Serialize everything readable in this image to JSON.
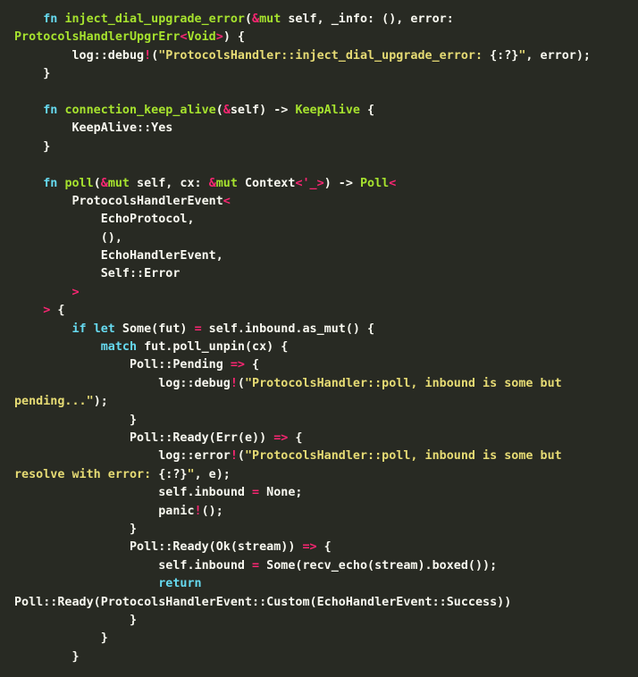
{
  "editor": {
    "language": "rust",
    "background_color": "#282a23",
    "foreground_color": "#f8f8f0",
    "theme_colors": {
      "keyword": "#66d9ef",
      "function_name": "#a6e22e",
      "type_name": "#a6e22e",
      "operator": "#f92672",
      "string": "#e6db74",
      "plain": "#f8f8f0"
    }
  },
  "code": {
    "lines": [
      {
        "n": 1,
        "text": "    fn inject_dial_upgrade_error(&mut self, _info: (), error:",
        "tokens": [
          {
            "t": "    ",
            "c": "t-plain"
          },
          {
            "t": "fn",
            "c": "t-kw"
          },
          {
            "t": " ",
            "c": "t-plain"
          },
          {
            "t": "inject_dial_upgrade_error",
            "c": "t-fname"
          },
          {
            "t": "(",
            "c": "t-plain"
          },
          {
            "t": "&",
            "c": "t-op"
          },
          {
            "t": "mut",
            "c": "t-mut"
          },
          {
            "t": " self, _info: (), error:",
            "c": "t-plain"
          }
        ]
      },
      {
        "n": 2,
        "text": "ProtocolsHandlerUpgrErr<Void>) {",
        "wrapped": true,
        "tokens": [
          {
            "t": "ProtocolsHandlerUpgrErr",
            "c": "t-fname"
          },
          {
            "t": "<",
            "c": "t-op"
          },
          {
            "t": "Void",
            "c": "t-fname"
          },
          {
            "t": ">",
            "c": "t-op"
          },
          {
            "t": ") {",
            "c": "t-plain"
          }
        ]
      },
      {
        "n": 3,
        "text": "        log::debug!(\"ProtocolsHandler::inject_dial_upgrade_error: {:?}\", error);",
        "tokens": [
          {
            "t": "        log::debug",
            "c": "t-plain"
          },
          {
            "t": "!",
            "c": "t-op"
          },
          {
            "t": "(",
            "c": "t-plain"
          },
          {
            "t": "\"ProtocolsHandler::inject_dial_upgrade_error: ",
            "c": "t-str"
          },
          {
            "t": "{:?}",
            "c": "t-strfmt"
          },
          {
            "t": "\"",
            "c": "t-str"
          },
          {
            "t": ", error);",
            "c": "t-plain"
          }
        ]
      },
      {
        "n": 4,
        "text": "    }",
        "tokens": [
          {
            "t": "    }",
            "c": "t-brace"
          }
        ]
      },
      {
        "n": 5,
        "text": "",
        "tokens": []
      },
      {
        "n": 6,
        "text": "    fn connection_keep_alive(&self) -> KeepAlive {",
        "tokens": [
          {
            "t": "    ",
            "c": "t-plain"
          },
          {
            "t": "fn",
            "c": "t-kw"
          },
          {
            "t": " ",
            "c": "t-plain"
          },
          {
            "t": "connection_keep_alive",
            "c": "t-fname"
          },
          {
            "t": "(",
            "c": "t-plain"
          },
          {
            "t": "&",
            "c": "t-op"
          },
          {
            "t": "self) -> ",
            "c": "t-plain"
          },
          {
            "t": "KeepAlive",
            "c": "t-type"
          },
          {
            "t": " {",
            "c": "t-plain"
          }
        ]
      },
      {
        "n": 7,
        "text": "        KeepAlive::Yes",
        "tokens": [
          {
            "t": "        KeepAlive::Yes",
            "c": "t-plain"
          }
        ]
      },
      {
        "n": 8,
        "text": "    }",
        "tokens": [
          {
            "t": "    }",
            "c": "t-brace"
          }
        ]
      },
      {
        "n": 9,
        "text": "",
        "tokens": []
      },
      {
        "n": 10,
        "text": "    fn poll(&mut self, cx: &mut Context<'_>) -> Poll<",
        "tokens": [
          {
            "t": "    ",
            "c": "t-plain"
          },
          {
            "t": "fn",
            "c": "t-kw"
          },
          {
            "t": " ",
            "c": "t-plain"
          },
          {
            "t": "poll",
            "c": "t-fname"
          },
          {
            "t": "(",
            "c": "t-plain"
          },
          {
            "t": "&",
            "c": "t-op"
          },
          {
            "t": "mut",
            "c": "t-mut"
          },
          {
            "t": " self, cx: ",
            "c": "t-plain"
          },
          {
            "t": "&",
            "c": "t-op"
          },
          {
            "t": "mut",
            "c": "t-mut"
          },
          {
            "t": " Context",
            "c": "t-plain"
          },
          {
            "t": "<'_>",
            "c": "t-op"
          },
          {
            "t": ") -> ",
            "c": "t-plain"
          },
          {
            "t": "Poll",
            "c": "t-type"
          },
          {
            "t": "<",
            "c": "t-op"
          }
        ]
      },
      {
        "n": 11,
        "text": "        ProtocolsHandlerEvent<",
        "tokens": [
          {
            "t": "        ProtocolsHandlerEvent",
            "c": "t-plain"
          },
          {
            "t": "<",
            "c": "t-op"
          }
        ]
      },
      {
        "n": 12,
        "text": "            EchoProtocol,",
        "tokens": [
          {
            "t": "            EchoProtocol,",
            "c": "t-plain"
          }
        ]
      },
      {
        "n": 13,
        "text": "            (),",
        "tokens": [
          {
            "t": "            (),",
            "c": "t-plain"
          }
        ]
      },
      {
        "n": 14,
        "text": "            EchoHandlerEvent,",
        "tokens": [
          {
            "t": "            EchoHandlerEvent,",
            "c": "t-plain"
          }
        ]
      },
      {
        "n": 15,
        "text": "            Self::Error",
        "tokens": [
          {
            "t": "            Self::Error",
            "c": "t-plain"
          }
        ]
      },
      {
        "n": 16,
        "text": "        >",
        "tokens": [
          {
            "t": "        ",
            "c": "t-plain"
          },
          {
            "t": ">",
            "c": "t-op"
          }
        ]
      },
      {
        "n": 17,
        "text": "    > {",
        "tokens": [
          {
            "t": "    ",
            "c": "t-plain"
          },
          {
            "t": ">",
            "c": "t-op"
          },
          {
            "t": " {",
            "c": "t-plain"
          }
        ]
      },
      {
        "n": 18,
        "text": "        if let Some(fut) = self.inbound.as_mut() {",
        "tokens": [
          {
            "t": "        ",
            "c": "t-plain"
          },
          {
            "t": "if",
            "c": "t-kw"
          },
          {
            "t": " ",
            "c": "t-plain"
          },
          {
            "t": "let",
            "c": "t-kw"
          },
          {
            "t": " Some(fut) ",
            "c": "t-plain"
          },
          {
            "t": "=",
            "c": "t-op"
          },
          {
            "t": " self.inbound.as_mut() {",
            "c": "t-plain"
          }
        ]
      },
      {
        "n": 19,
        "text": "            match fut.poll_unpin(cx) {",
        "tokens": [
          {
            "t": "            ",
            "c": "t-plain"
          },
          {
            "t": "match",
            "c": "t-kw"
          },
          {
            "t": " fut.poll_unpin(cx) {",
            "c": "t-plain"
          }
        ]
      },
      {
        "n": 20,
        "text": "                Poll::Pending => {",
        "tokens": [
          {
            "t": "                Poll::Pending ",
            "c": "t-plain"
          },
          {
            "t": "=>",
            "c": "t-op"
          },
          {
            "t": " {",
            "c": "t-plain"
          }
        ]
      },
      {
        "n": 21,
        "text": "                    log::debug!(\"ProtocolsHandler::poll, inbound is some but",
        "tokens": [
          {
            "t": "                    log::debug",
            "c": "t-plain"
          },
          {
            "t": "!",
            "c": "t-op"
          },
          {
            "t": "(",
            "c": "t-plain"
          },
          {
            "t": "\"ProtocolsHandler::poll, inbound is some but",
            "c": "t-str"
          }
        ]
      },
      {
        "n": 22,
        "text": "pending...\");",
        "wrapped": true,
        "tokens": [
          {
            "t": "pending...\"",
            "c": "t-str"
          },
          {
            "t": ");",
            "c": "t-plain"
          }
        ]
      },
      {
        "n": 23,
        "text": "                }",
        "tokens": [
          {
            "t": "                }",
            "c": "t-brace"
          }
        ]
      },
      {
        "n": 24,
        "text": "                Poll::Ready(Err(e)) => {",
        "tokens": [
          {
            "t": "                Poll::Ready(Err(e)) ",
            "c": "t-plain"
          },
          {
            "t": "=>",
            "c": "t-op"
          },
          {
            "t": " {",
            "c": "t-plain"
          }
        ]
      },
      {
        "n": 25,
        "text": "                    log::error!(\"ProtocolsHandler::poll, inbound is some but",
        "tokens": [
          {
            "t": "                    log::error",
            "c": "t-plain"
          },
          {
            "t": "!",
            "c": "t-op"
          },
          {
            "t": "(",
            "c": "t-plain"
          },
          {
            "t": "\"ProtocolsHandler::poll, inbound is some but",
            "c": "t-str"
          }
        ]
      },
      {
        "n": 26,
        "text": "resolve with error: {:?}\", e);",
        "wrapped": true,
        "tokens": [
          {
            "t": "resolve with error: ",
            "c": "t-str"
          },
          {
            "t": "{:?}",
            "c": "t-strfmt"
          },
          {
            "t": "\"",
            "c": "t-str"
          },
          {
            "t": ", e);",
            "c": "t-plain"
          }
        ]
      },
      {
        "n": 27,
        "text": "                    self.inbound = None;",
        "tokens": [
          {
            "t": "                    self.inbound ",
            "c": "t-plain"
          },
          {
            "t": "=",
            "c": "t-op"
          },
          {
            "t": " None;",
            "c": "t-plain"
          }
        ]
      },
      {
        "n": 28,
        "text": "                    panic!();",
        "tokens": [
          {
            "t": "                    panic",
            "c": "t-plain"
          },
          {
            "t": "!",
            "c": "t-op"
          },
          {
            "t": "();",
            "c": "t-plain"
          }
        ]
      },
      {
        "n": 29,
        "text": "                }",
        "tokens": [
          {
            "t": "                }",
            "c": "t-brace"
          }
        ]
      },
      {
        "n": 30,
        "text": "                Poll::Ready(Ok(stream)) => {",
        "tokens": [
          {
            "t": "                Poll::Ready(Ok(stream)) ",
            "c": "t-plain"
          },
          {
            "t": "=>",
            "c": "t-op"
          },
          {
            "t": " {",
            "c": "t-plain"
          }
        ]
      },
      {
        "n": 31,
        "text": "                    self.inbound = Some(recv_echo(stream).boxed());",
        "tokens": [
          {
            "t": "                    self.inbound ",
            "c": "t-plain"
          },
          {
            "t": "=",
            "c": "t-op"
          },
          {
            "t": " Some(recv_echo(stream).boxed());",
            "c": "t-plain"
          }
        ]
      },
      {
        "n": 32,
        "text": "                    return",
        "tokens": [
          {
            "t": "                    ",
            "c": "t-plain"
          },
          {
            "t": "return",
            "c": "t-kw"
          }
        ]
      },
      {
        "n": 33,
        "text": "Poll::Ready(ProtocolsHandlerEvent::Custom(EchoHandlerEvent::Success))",
        "wrapped": true,
        "tokens": [
          {
            "t": "Poll::Ready(ProtocolsHandlerEvent::Custom(EchoHandlerEvent::Success))",
            "c": "t-plain"
          }
        ]
      },
      {
        "n": 34,
        "text": "                }",
        "tokens": [
          {
            "t": "                }",
            "c": "t-brace"
          }
        ]
      },
      {
        "n": 35,
        "text": "            }",
        "tokens": [
          {
            "t": "            }",
            "c": "t-brace"
          }
        ]
      },
      {
        "n": 36,
        "text": "        }",
        "tokens": [
          {
            "t": "        }",
            "c": "t-brace"
          }
        ]
      }
    ]
  }
}
